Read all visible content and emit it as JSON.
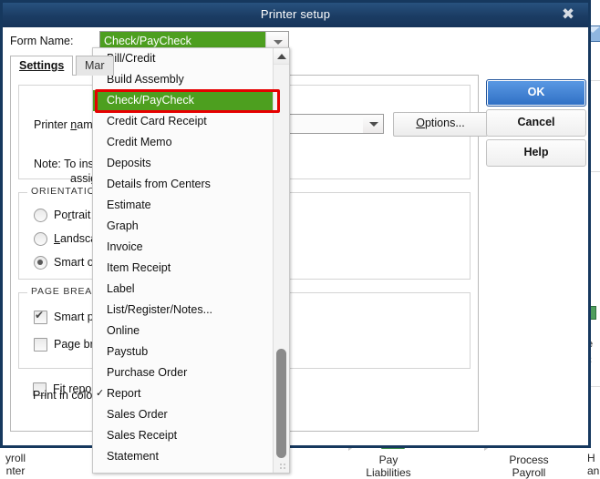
{
  "window": {
    "title": "Printer setup",
    "close_label": "✖"
  },
  "form_name": {
    "label": "Form Name:",
    "value": "Check/PayCheck",
    "arrow_icon": "chevron-down-icon"
  },
  "tabs": [
    {
      "label": "Settings",
      "active": true
    },
    {
      "label": "Mar",
      "active": false
    }
  ],
  "settings": {
    "printer_name_label": "Printer name:",
    "printer_name_value": "",
    "options_button": "Options...",
    "note_line1": "Note: To install",
    "note_line2": "assignm",
    "orientation_title": "ORIENTATION:",
    "orientation_options": [
      {
        "label": "Portrait",
        "selected": false
      },
      {
        "label": "Landscape",
        "selected": false
      },
      {
        "label": "Smart orien",
        "selected": true
      }
    ],
    "page_breaks_title": "PAGE BREAKS:",
    "page_break_options": [
      {
        "label": "Smart page",
        "checked": true
      },
      {
        "label": "Page break",
        "checked": false
      }
    ],
    "fit_report_label": "Fit report to",
    "fit_report_checked": false,
    "print_in_color_label": "Print in color (color printers only)"
  },
  "buttons": {
    "ok": "OK",
    "cancel": "Cancel",
    "help": "Help"
  },
  "dropdown": {
    "items": [
      {
        "label": "Bill/Credit",
        "checked": false,
        "selected": false
      },
      {
        "label": "Build Assembly",
        "checked": false,
        "selected": false
      },
      {
        "label": "Check/PayCheck",
        "checked": false,
        "selected": true
      },
      {
        "label": "Credit Card Receipt",
        "checked": false,
        "selected": false
      },
      {
        "label": "Credit Memo",
        "checked": false,
        "selected": false
      },
      {
        "label": "Deposits",
        "checked": false,
        "selected": false
      },
      {
        "label": "Details from Centers",
        "checked": false,
        "selected": false
      },
      {
        "label": "Estimate",
        "checked": false,
        "selected": false
      },
      {
        "label": "Graph",
        "checked": false,
        "selected": false
      },
      {
        "label": "Invoice",
        "checked": false,
        "selected": false
      },
      {
        "label": "Item Receipt",
        "checked": false,
        "selected": false
      },
      {
        "label": "Label",
        "checked": false,
        "selected": false
      },
      {
        "label": "List/Register/Notes...",
        "checked": false,
        "selected": false
      },
      {
        "label": "Online",
        "checked": false,
        "selected": false
      },
      {
        "label": "Paystub",
        "checked": false,
        "selected": false
      },
      {
        "label": "Purchase Order",
        "checked": false,
        "selected": false
      },
      {
        "label": "Report",
        "checked": true,
        "selected": false
      },
      {
        "label": "Sales Order",
        "checked": false,
        "selected": false
      },
      {
        "label": "Sales Receipt",
        "checked": false,
        "selected": false
      },
      {
        "label": "Statement",
        "checked": false,
        "selected": false
      }
    ],
    "check_glyph": "✓",
    "scroll_up_icon": "triangle-up-icon"
  },
  "background": {
    "flow_items": [
      {
        "label_line1": "yroll",
        "label_line2": "nter",
        "icon": "payroll-center-icon"
      },
      {
        "label_line1": "Pay",
        "label_line2": "Liabilities",
        "icon": "pay-liabilities-icon"
      },
      {
        "label_line1": "Process",
        "label_line2": "Payroll",
        "icon": "process-payroll-icon"
      },
      {
        "label_line1": "H",
        "label_line2": "an",
        "icon": "partial-icon"
      }
    ],
    "right_column": {
      "mail_icon": "mail-icon",
      "text_a": "a",
      "text_te": "te",
      "text_c": "C",
      "money_icon": "money-icon"
    }
  },
  "annotation": {
    "type": "red-highlight-box",
    "color": "#e50000",
    "target": "Check/PayCheck"
  },
  "colors": {
    "titlebar": "#1b3c63",
    "selection_green": "#4d9f1f",
    "annotation_red": "#e50000",
    "ok_blue": "#2f6fc4"
  }
}
